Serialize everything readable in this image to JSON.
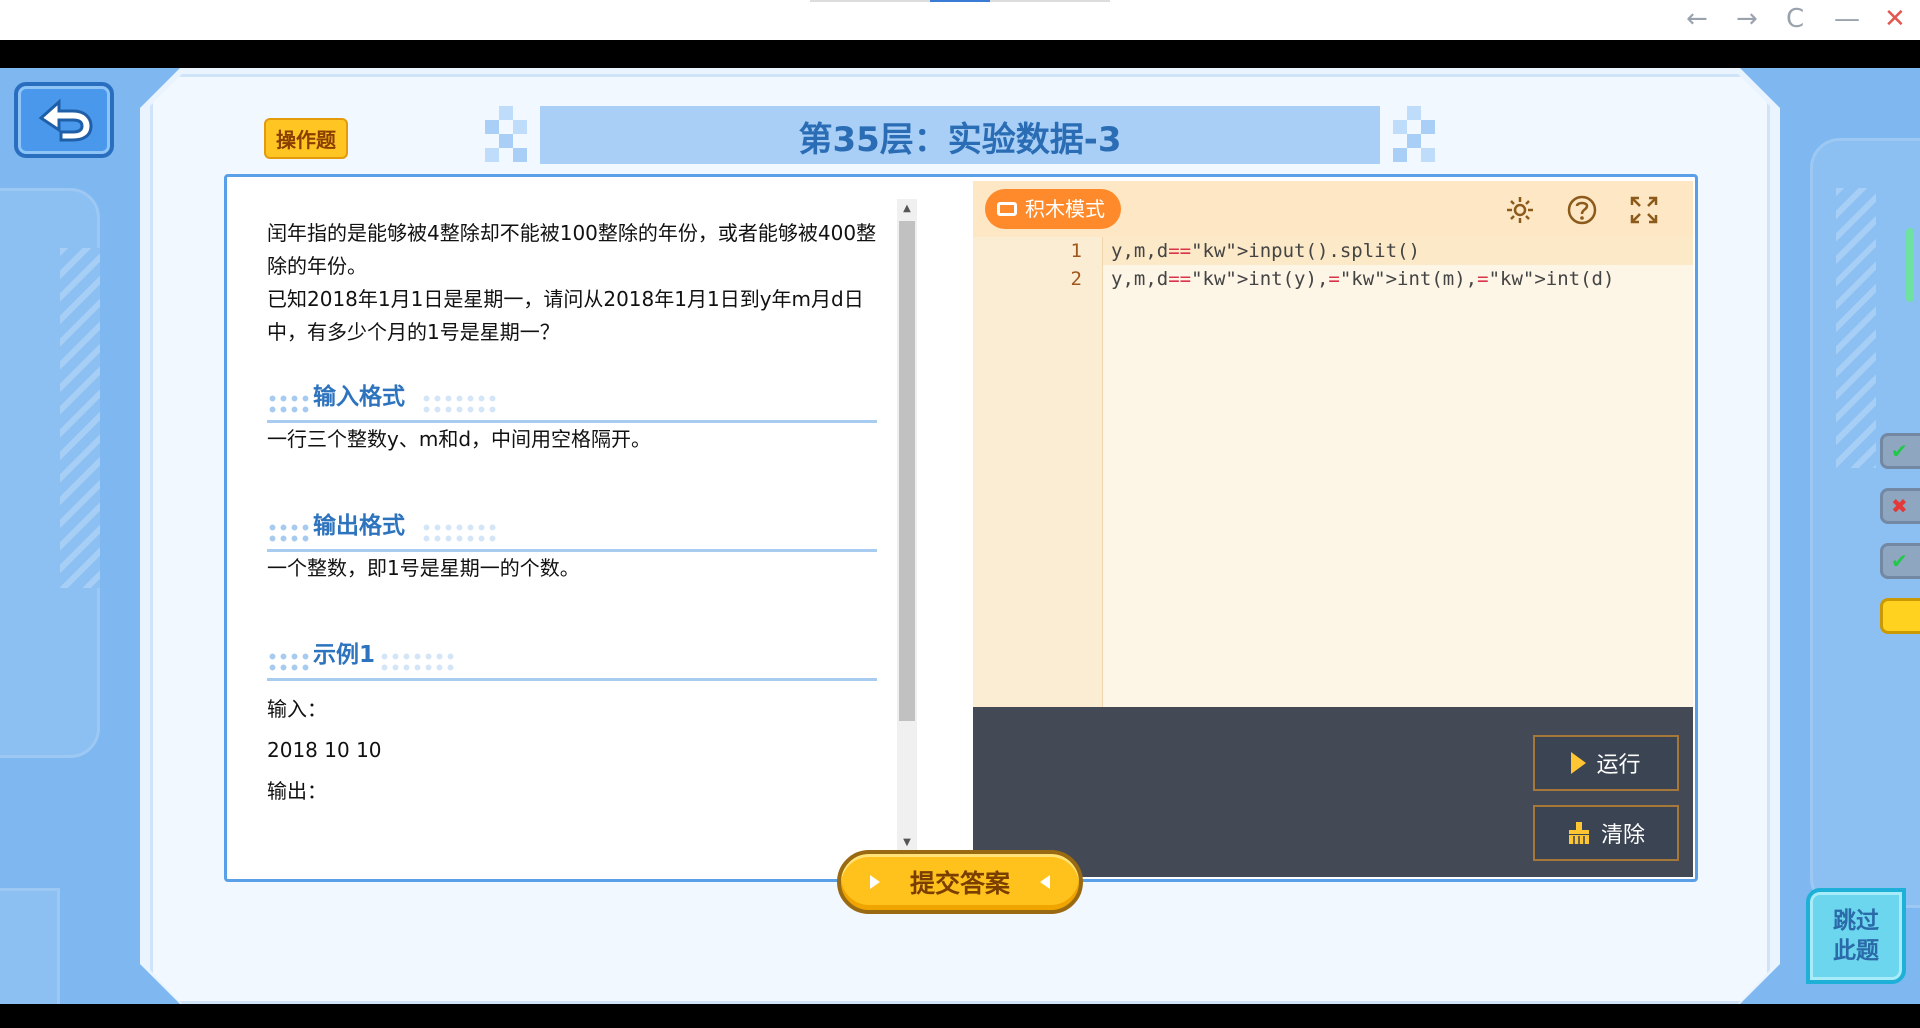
{
  "window": {
    "controls": {
      "back": "←",
      "forward": "→",
      "reload": "C",
      "minimize": "—",
      "close": "✕"
    }
  },
  "header": {
    "badge": "操作题",
    "title": "第35层：实验数据-3"
  },
  "problem": {
    "description": [
      "闰年指的是能够被4整除却不能被100整除的年份，或者能够被400整除的年份。",
      "已知2018年1月1日是星期一，请问从2018年1月1日到y年m月d日中，有多少个月的1号是星期一？"
    ],
    "sections": [
      {
        "label": "输入格式",
        "body": "一行三个整数y、m和d，中间用空格隔开。"
      },
      {
        "label": "输出格式",
        "body": "一个整数，即1号是星期一的个数。"
      },
      {
        "label": "示例1"
      }
    ],
    "example": {
      "input_label": "输入：",
      "input_value": "2018 10 10",
      "output_label": "输出："
    }
  },
  "editor": {
    "block_mode_label": "积木模式",
    "icons": [
      "settings-icon",
      "help-icon",
      "fullscreen-icon"
    ],
    "lines": [
      {
        "number": "1",
        "code": "y,m,d=input().split()"
      },
      {
        "number": "2",
        "code": "y,m,d=int(y),int(m),int(d)"
      }
    ],
    "run_label": "运行",
    "clear_label": "清除"
  },
  "footer": {
    "submit_label": "提交答案",
    "skip_label_1": "跳过",
    "skip_label_2": "此题"
  },
  "side_tabs": [
    {
      "status": "pass",
      "glyph": "✔",
      "color": "#21c94a"
    },
    {
      "status": "fail",
      "glyph": "✖",
      "color": "#e23a3a"
    },
    {
      "status": "pass",
      "glyph": "✔",
      "color": "#21c94a"
    },
    {
      "status": "current",
      "glyph": "",
      "color": "#ffd21f"
    }
  ],
  "colors": {
    "accent": "#2b6db5",
    "orange": "#ff8a2b",
    "submit": "#ffc21c"
  }
}
